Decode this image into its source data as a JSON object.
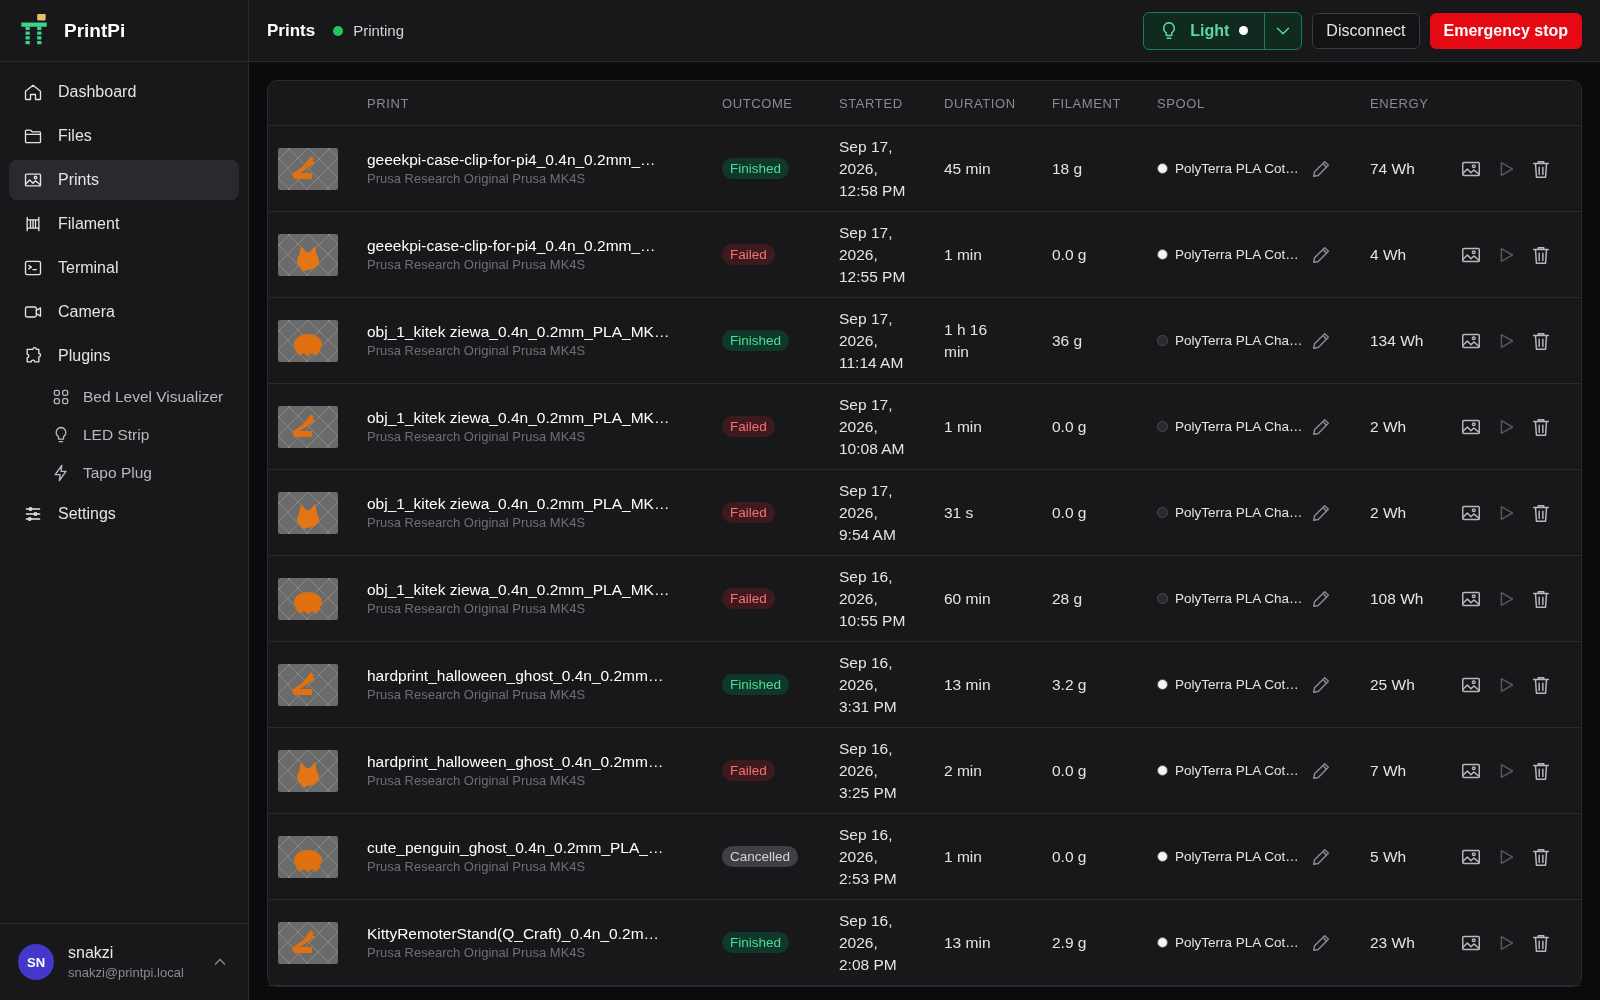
{
  "app": {
    "name": "PrintPi"
  },
  "sidebar": {
    "items": [
      {
        "label": "Dashboard",
        "selected": false
      },
      {
        "label": "Files",
        "selected": false
      },
      {
        "label": "Prints",
        "selected": true
      },
      {
        "label": "Filament",
        "selected": false
      },
      {
        "label": "Terminal",
        "selected": false
      },
      {
        "label": "Camera",
        "selected": false
      },
      {
        "label": "Plugins",
        "selected": false,
        "children": [
          {
            "label": "Bed Level Visualizer",
            "selected": false
          },
          {
            "label": "LED Strip",
            "selected": false
          },
          {
            "label": "Tapo Plug",
            "selected": false
          }
        ]
      },
      {
        "label": "Settings",
        "selected": false
      }
    ]
  },
  "user": {
    "initials": "SN",
    "name": "snakzi",
    "email": "snakzi@printpi.local"
  },
  "header": {
    "title": "Prints",
    "status": {
      "label": "Printing",
      "color": "#22c55e"
    },
    "light": {
      "label": "Light",
      "on": true
    },
    "buttons": [
      {
        "label": "Disconnect",
        "kind": "outline"
      },
      {
        "label": "Emergency stop",
        "kind": "danger"
      }
    ]
  },
  "table": {
    "columns": [
      "PRINT",
      "OUTCOME",
      "STARTED",
      "DURATION",
      "FILAMENT",
      "SPOOL",
      "ENERGY"
    ],
    "rows": [
      {
        "name": "geeekpi-case-clip-for-pi4_0.4n_0.2mm_…",
        "printer": "Prusa Research Original Prusa MK4S",
        "outcome": "Finished",
        "kind": "finished",
        "started": "Sep 17, 2026, 12:58 PM",
        "duration": "45 min",
        "filament": "18 g",
        "spool": {
          "name": "PolyTerra PLA Cot…",
          "color": "#f4f4f5"
        },
        "energy": "74 Wh"
      },
      {
        "name": "geeekpi-case-clip-for-pi4_0.4n_0.2mm_…",
        "printer": "Prusa Research Original Prusa MK4S",
        "outcome": "Failed",
        "kind": "failed",
        "started": "Sep 17, 2026, 12:55 PM",
        "duration": "1 min",
        "filament": "0.0 g",
        "spool": {
          "name": "PolyTerra PLA Cot…",
          "color": "#f4f4f5"
        },
        "energy": "4 Wh"
      },
      {
        "name": "obj_1_kitek ziewa_0.4n_0.2mm_PLA_MK…",
        "printer": "Prusa Research Original Prusa MK4S",
        "outcome": "Finished",
        "kind": "finished",
        "started": "Sep 17, 2026, 11:14 AM",
        "duration": "1 h 16 min",
        "filament": "36 g",
        "spool": {
          "name": "PolyTerra PLA Cha…",
          "color": "#2a2a2e"
        },
        "energy": "134 Wh"
      },
      {
        "name": "obj_1_kitek ziewa_0.4n_0.2mm_PLA_MK…",
        "printer": "Prusa Research Original Prusa MK4S",
        "outcome": "Failed",
        "kind": "failed",
        "started": "Sep 17, 2026, 10:08 AM",
        "duration": "1 min",
        "filament": "0.0 g",
        "spool": {
          "name": "PolyTerra PLA Cha…",
          "color": "#2a2a2e"
        },
        "energy": "2 Wh"
      },
      {
        "name": "obj_1_kitek ziewa_0.4n_0.2mm_PLA_MK…",
        "printer": "Prusa Research Original Prusa MK4S",
        "outcome": "Failed",
        "kind": "failed",
        "started": "Sep 17, 2026, 9:54 AM",
        "duration": "31 s",
        "filament": "0.0 g",
        "spool": {
          "name": "PolyTerra PLA Cha…",
          "color": "#2a2a2e"
        },
        "energy": "2 Wh"
      },
      {
        "name": "obj_1_kitek ziewa_0.4n_0.2mm_PLA_MK…",
        "printer": "Prusa Research Original Prusa MK4S",
        "outcome": "Failed",
        "kind": "failed",
        "started": "Sep 16, 2026, 10:55 PM",
        "duration": "60 min",
        "filament": "28 g",
        "spool": {
          "name": "PolyTerra PLA Cha…",
          "color": "#2a2a2e"
        },
        "energy": "108 Wh"
      },
      {
        "name": "hardprint_halloween_ghost_0.4n_0.2mm…",
        "printer": "Prusa Research Original Prusa MK4S",
        "outcome": "Finished",
        "kind": "finished",
        "started": "Sep 16, 2026, 3:31 PM",
        "duration": "13 min",
        "filament": "3.2 g",
        "spool": {
          "name": "PolyTerra PLA Cot…",
          "color": "#f4f4f5"
        },
        "energy": "25 Wh"
      },
      {
        "name": "hardprint_halloween_ghost_0.4n_0.2mm…",
        "printer": "Prusa Research Original Prusa MK4S",
        "outcome": "Failed",
        "kind": "failed",
        "started": "Sep 16, 2026, 3:25 PM",
        "duration": "2 min",
        "filament": "0.0 g",
        "spool": {
          "name": "PolyTerra PLA Cot…",
          "color": "#f4f4f5"
        },
        "energy": "7 Wh"
      },
      {
        "name": "cute_penguin_ghost_0.4n_0.2mm_PLA_…",
        "printer": "Prusa Research Original Prusa MK4S",
        "outcome": "Cancelled",
        "kind": "cancelled",
        "started": "Sep 16, 2026, 2:53 PM",
        "duration": "1 min",
        "filament": "0.0 g",
        "spool": {
          "name": "PolyTerra PLA Cot…",
          "color": "#f4f4f5"
        },
        "energy": "5 Wh"
      },
      {
        "name": "KittyRemoterStand(Q_Craft)_0.4n_0.2m…",
        "printer": "Prusa Research Original Prusa MK4S",
        "outcome": "Finished",
        "kind": "finished",
        "started": "Sep 16, 2026, 2:08 PM",
        "duration": "13 min",
        "filament": "2.9 g",
        "spool": {
          "name": "PolyTerra PLA Cot…",
          "color": "#f4f4f5"
        },
        "energy": "23 Wh"
      }
    ]
  }
}
